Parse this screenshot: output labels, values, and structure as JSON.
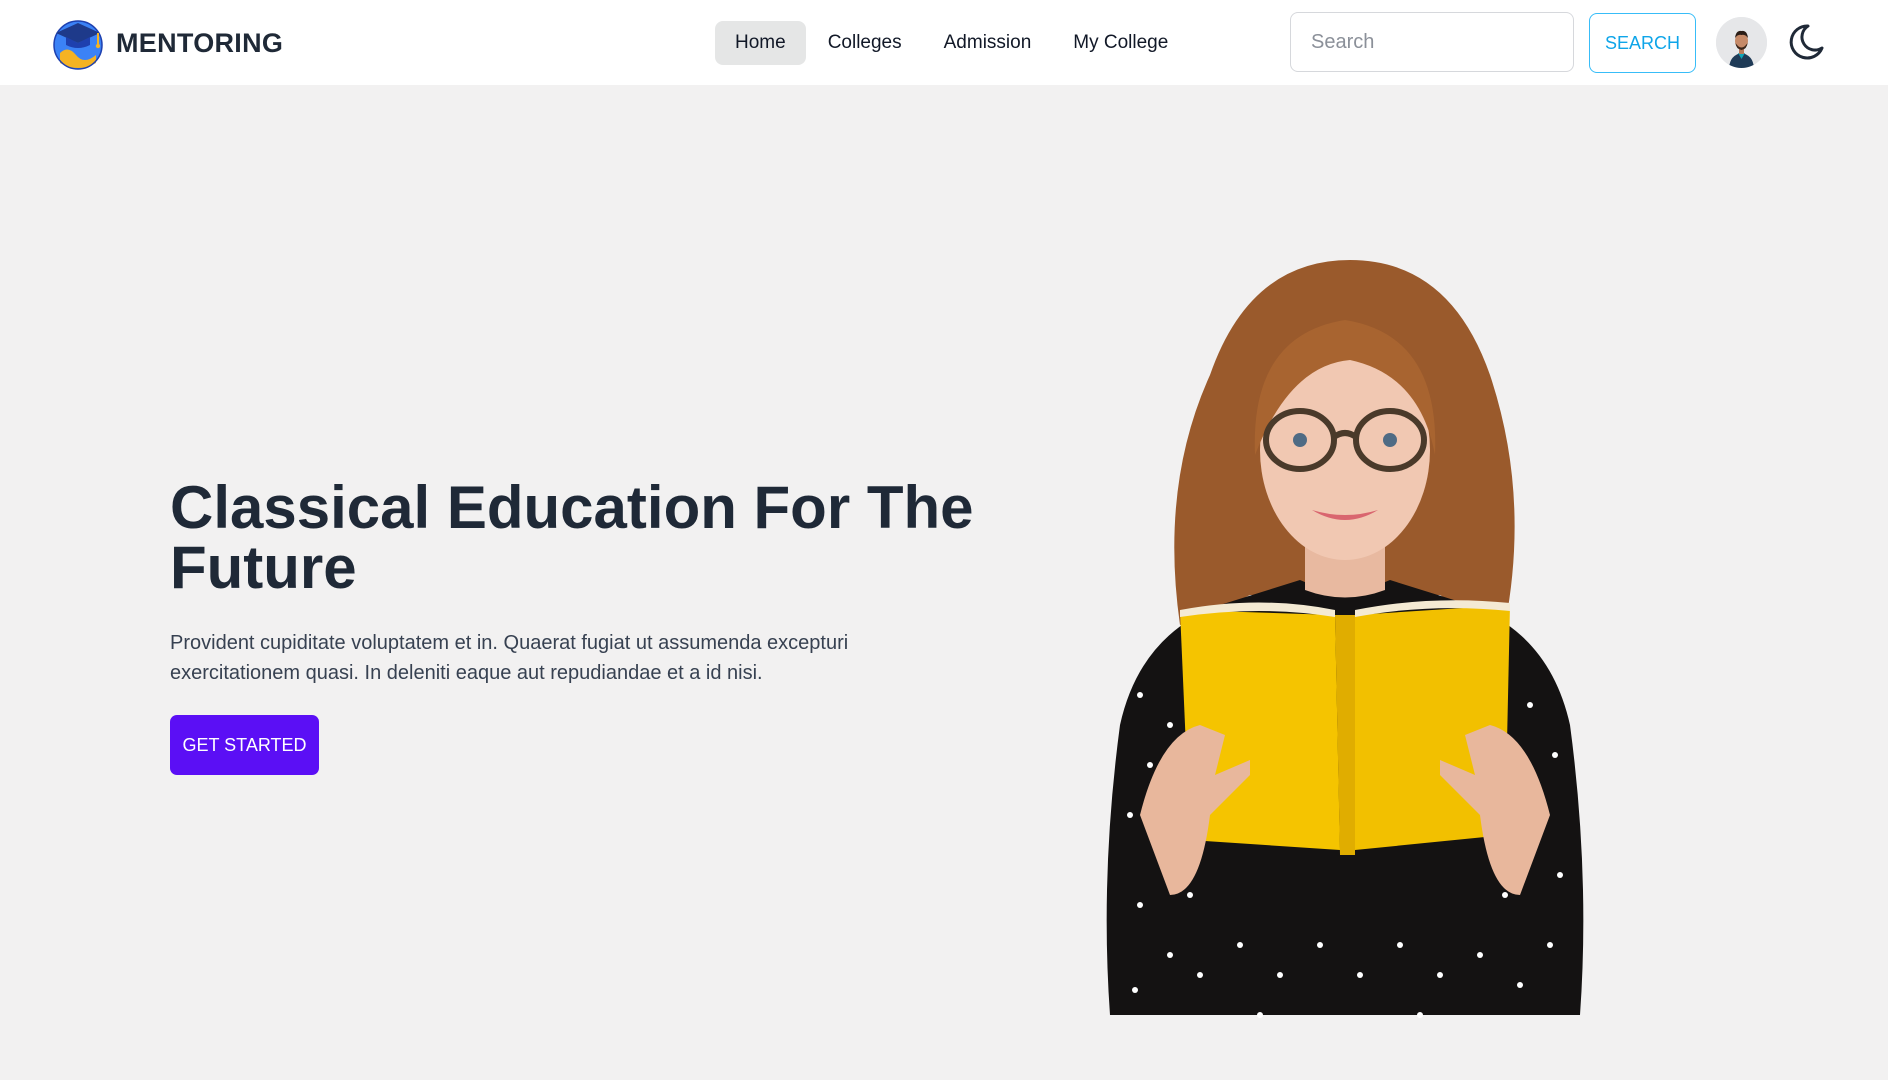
{
  "brand": {
    "name": "MENTORING",
    "logo_icon": "graduation-cap-globe-icon"
  },
  "nav": {
    "items": [
      {
        "label": "Home",
        "active": true
      },
      {
        "label": "Colleges",
        "active": false
      },
      {
        "label": "Admission",
        "active": false
      },
      {
        "label": "My College",
        "active": false
      }
    ]
  },
  "search": {
    "placeholder": "Search",
    "value": "",
    "button_label": "SEARCH"
  },
  "header_actions": {
    "avatar_icon": "user-avatar",
    "theme_icon": "moon-icon"
  },
  "hero": {
    "title": "Classical Education For The Future",
    "description": "Provident cupiditate voluptatem et in. Quaerat fugiat ut assumenda excepturi exercitationem quasi. In deleniti eaque aut repudiandae et a id nisi.",
    "cta_label": "GET STARTED",
    "image_icon": "student-reading-book-image"
  },
  "colors": {
    "background": "#f2f1f1",
    "accent": "#5b0ff5",
    "search_border": "#38bdf8",
    "book_yellow": "#f5c400"
  }
}
